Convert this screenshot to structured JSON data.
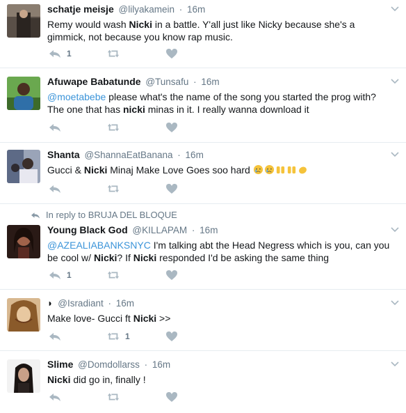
{
  "tweets": [
    {
      "name": "schatje meisje",
      "handle": "@lilyakamein",
      "sep": "·",
      "time": "16m",
      "text_parts": [
        "Remy would wash ",
        "Nicki",
        " in a battle. Y'all just like Nicky because she's a\ngimmick, not because you know rap music."
      ],
      "reply_count": "1",
      "retweet_count": "",
      "like_count": ""
    },
    {
      "name": "Afuwape Babatunde",
      "handle": "@Tunsafu",
      "sep": "·",
      "time": "16m",
      "mention": "@moetabebe",
      "text_parts": [
        " please what's the name of the song you started the prog with?\nThe one that has ",
        "nicki",
        " minas in it. I really wanna download it"
      ],
      "reply_count": "",
      "retweet_count": "",
      "like_count": ""
    },
    {
      "name": "Shanta",
      "handle": "@ShannaEatBanana",
      "sep": "·",
      "time": "16m",
      "text_parts": [
        "Gucci & ",
        "Nicki",
        " Minaj Make Love Goes soo hard "
      ],
      "emojis": [
        "crying-face",
        "crying-face",
        "raised-hands",
        "raised-hands",
        "clapping-hands"
      ],
      "reply_count": "",
      "retweet_count": "",
      "like_count": ""
    },
    {
      "reply_context": "In reply to BRUJA DEL BLOQUE",
      "name": "Young Black God",
      "handle": "@KILLAPAM",
      "sep": "·",
      "time": "16m",
      "mention": "@AZEALIABANKSNYC",
      "text_parts": [
        " I'm talking abt the Head Negress which is you, can you\nbe cool w/ ",
        "Nicki",
        "? If ",
        "Nicki",
        " responded I'd be asking the same thing"
      ],
      "reply_count": "1",
      "retweet_count": "",
      "like_count": ""
    },
    {
      "name": "◗",
      "handle": "@Isradiant",
      "sep": "·",
      "time": "16m",
      "text_parts": [
        "Make love- Gucci ft ",
        "Nicki",
        " >>"
      ],
      "reply_count": "",
      "retweet_count": "1",
      "like_count": ""
    },
    {
      "name": "Slime",
      "handle": "@Domdollarss",
      "sep": "·",
      "time": "16m",
      "text_parts": [
        "Nicki",
        " did go in, finally !"
      ],
      "reply_count": "",
      "retweet_count": "",
      "like_count": ""
    }
  ],
  "colors": {
    "icon": "#aab8c2",
    "mention": "#3b94d9",
    "divider": "#e6ecf0",
    "muted": "#657786"
  }
}
